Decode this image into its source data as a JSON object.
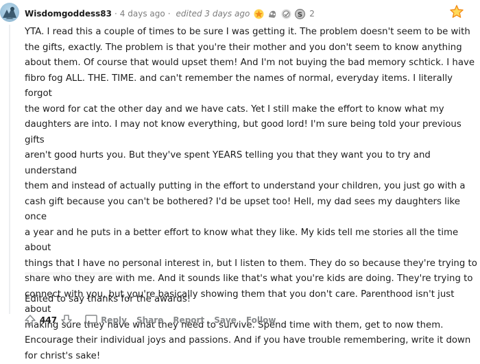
{
  "comment": {
    "username": "Wisdomgoddess83",
    "posted": "4 days ago",
    "edited": "edited 3 days ago",
    "award_count": "2",
    "paragraph_lines": [
      "YTA. I read this a couple of times to be sure I was getting it. The problem doesn't seem to be with",
      "the gifts, exactly. The problem is that you're their mother and you don't seem to know anything",
      "about them. Of course that would upset them! And I'm not buying the bad memory schtick. I have",
      "fibro fog ALL. THE. TIME. and can't remember the names of normal, everyday items. I literally forgot",
      "the word for cat the other day and we have cats. Yet I still make the effort to know what my",
      "daughters are into. I may not know everything, but good lord! I'm sure being told your previous gifts",
      "aren't good hurts you. But they've spent YEARS telling you that they want you to try and understand",
      "them and instead of actually putting in the effort to understand your children, you just go with a",
      "cash gift because you can't be bothered? I'd be upset too! Hell, my dad sees my daughters like once",
      "a year and he puts in a better effort to know what they like. My kids tell me stories all the time about",
      "things that I have no personal interest in, but I listen to them. They do so because they're trying to",
      "share who they are with me. And it sounds like that's what you're kids are doing. They're trying to",
      "connect with you, but you're basically showing them that you don't care. Parenthood isn't just about",
      "making sure they have what they need to survive. Spend time with them, get to now them.",
      "Encourage their individual joys and passions. And if you have trouble remembering, write it down",
      "for christ's sake!"
    ],
    "edit_note": "Edited to say thanks for the awards!",
    "score": "447"
  },
  "actions": {
    "reply": "Reply",
    "share": "Share",
    "report": "Report",
    "save": "Save",
    "follow": "Follow"
  },
  "icons": {
    "avatar": "avatar-icon",
    "awards": [
      "wholesome-award-icon",
      "silver-award-icon",
      "helpful-award-icon",
      "coin-award-icon"
    ],
    "corner": "star-award-icon",
    "upvote": "upvote-icon",
    "downvote": "downvote-icon",
    "reply": "comment-bubble-icon"
  },
  "colors": {
    "text": "#1c1c1c",
    "meta": "#7c7c7c",
    "action": "#878a8c",
    "award_gold": "#f2a12c"
  }
}
